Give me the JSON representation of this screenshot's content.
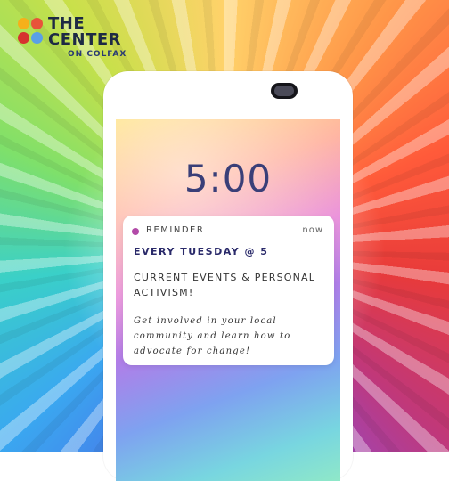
{
  "logo": {
    "line1": "THE",
    "line2": "CENTER",
    "subline": "ON COLFAX",
    "dot_colors": [
      "#f5b01a",
      "#e8533a",
      "#d6322f",
      "#5aa0e6"
    ]
  },
  "lockscreen": {
    "time": "5:00"
  },
  "notification": {
    "label": "REMINDER",
    "time": "now",
    "heading": "EVERY TUESDAY @ 5",
    "title": "CURRENT EVENTS & PERSONAL ACTIVISM!",
    "body": "Get involved in your local community and learn how to advocate for change!",
    "dot_color": "#b24aa8"
  },
  "colors": {
    "clock_text": "#3a3f78",
    "heading_text": "#2a2a6a"
  }
}
